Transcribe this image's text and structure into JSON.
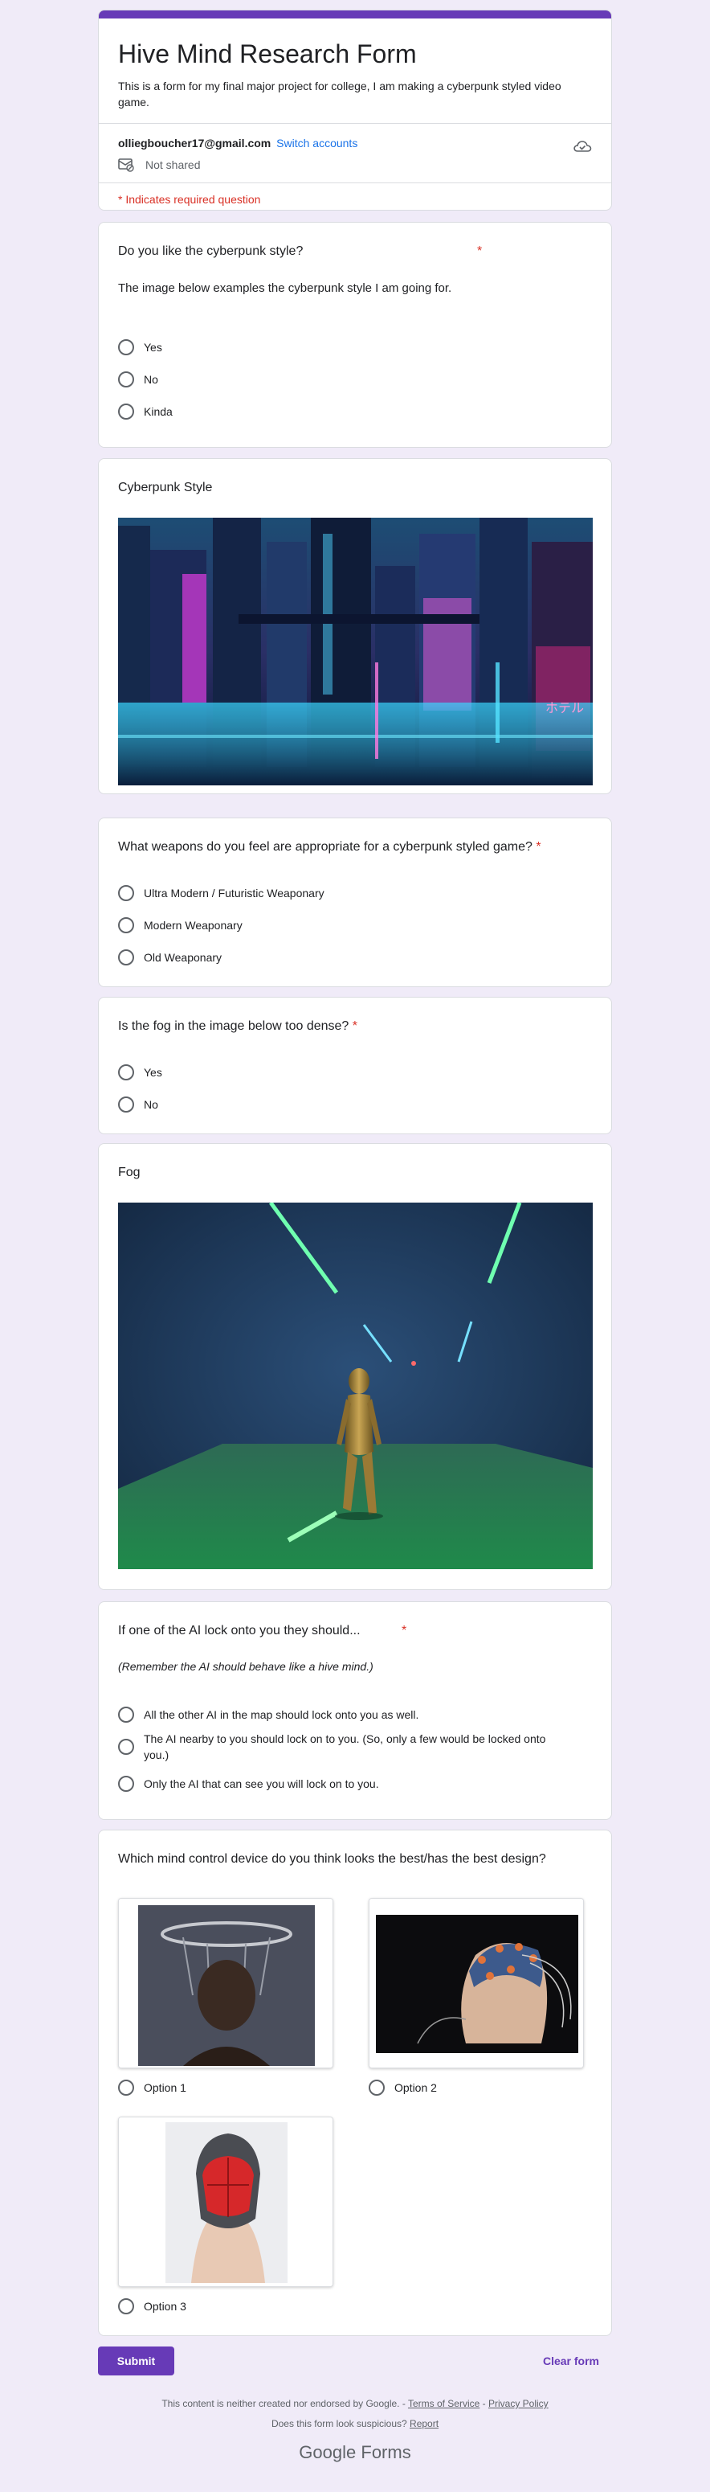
{
  "header": {
    "title": "Hive Mind Research Form",
    "description": "This is a form for my final major project for college, I am making a cyberpunk styled video game.",
    "account_email": "olliegboucher17@gmail.com",
    "switch_accounts": "Switch accounts",
    "not_shared": "Not shared",
    "required_note": "* Indicates required question"
  },
  "q1": {
    "title": "Do you like the cyberpunk style?",
    "description": "The image below examples the cyberpunk style I am going for.",
    "options": [
      "Yes",
      "No",
      "Kinda"
    ]
  },
  "section_cyberpunk": {
    "title": "Cyberpunk Style",
    "neon_sign": "ホテル"
  },
  "q2": {
    "title": "What weapons do you feel are appropriate for a cyberpunk styled game?",
    "options": [
      "Ultra Modern / Futuristic Weaponary",
      "Modern Weaponary",
      "Old Weaponary"
    ]
  },
  "q3": {
    "title": "Is the fog in the image below too dense?",
    "options": [
      "Yes",
      "No"
    ]
  },
  "section_fog": {
    "title": "Fog"
  },
  "q4": {
    "title": "If one of the AI lock onto you they should...",
    "description": "(Remember the AI should behave like a hive mind.)",
    "options": [
      "All the other AI in the map should lock onto you as well.",
      "The AI nearby to you should lock on to you. (So, only a few would be locked onto you.)",
      "Only the AI that can see you will lock on to you."
    ]
  },
  "q5": {
    "title": "Which mind control device do you think looks the best/has the best design?",
    "options": [
      "Option 1",
      "Option 2",
      "Option 3"
    ]
  },
  "actions": {
    "submit": "Submit",
    "clear": "Clear form"
  },
  "footer": {
    "disclaimer": "This content is neither created nor endorsed by Google.",
    "separator": " - ",
    "terms": "Terms of Service",
    "privacy": "Privacy Policy",
    "suspicious": "Does this form look suspicious?",
    "report": "Report",
    "logo_google": "Google",
    "logo_forms": "Forms"
  },
  "colors": {
    "accent": "#673ab7",
    "required": "#d93025",
    "link": "#1a73e8",
    "background": "#f0ebf8"
  }
}
